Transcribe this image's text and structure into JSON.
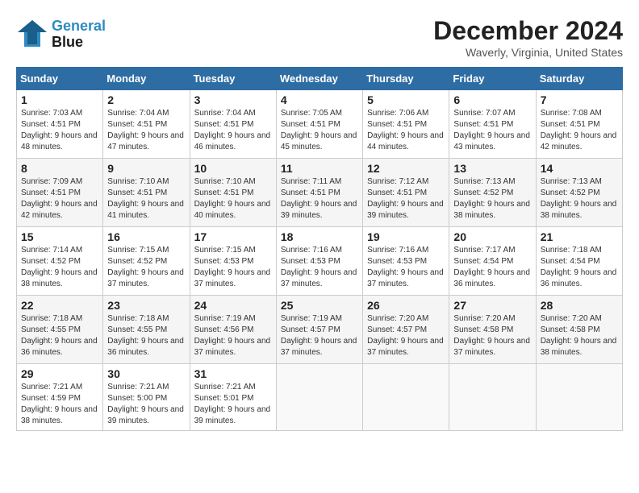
{
  "logo": {
    "line1": "General",
    "line2": "Blue"
  },
  "title": "December 2024",
  "location": "Waverly, Virginia, United States",
  "headers": [
    "Sunday",
    "Monday",
    "Tuesday",
    "Wednesday",
    "Thursday",
    "Friday",
    "Saturday"
  ],
  "weeks": [
    [
      {
        "day": "1",
        "sunrise": "7:03 AM",
        "sunset": "4:51 PM",
        "daylight": "9 hours and 48 minutes."
      },
      {
        "day": "2",
        "sunrise": "7:04 AM",
        "sunset": "4:51 PM",
        "daylight": "9 hours and 47 minutes."
      },
      {
        "day": "3",
        "sunrise": "7:04 AM",
        "sunset": "4:51 PM",
        "daylight": "9 hours and 46 minutes."
      },
      {
        "day": "4",
        "sunrise": "7:05 AM",
        "sunset": "4:51 PM",
        "daylight": "9 hours and 45 minutes."
      },
      {
        "day": "5",
        "sunrise": "7:06 AM",
        "sunset": "4:51 PM",
        "daylight": "9 hours and 44 minutes."
      },
      {
        "day": "6",
        "sunrise": "7:07 AM",
        "sunset": "4:51 PM",
        "daylight": "9 hours and 43 minutes."
      },
      {
        "day": "7",
        "sunrise": "7:08 AM",
        "sunset": "4:51 PM",
        "daylight": "9 hours and 42 minutes."
      }
    ],
    [
      {
        "day": "8",
        "sunrise": "7:09 AM",
        "sunset": "4:51 PM",
        "daylight": "9 hours and 42 minutes."
      },
      {
        "day": "9",
        "sunrise": "7:10 AM",
        "sunset": "4:51 PM",
        "daylight": "9 hours and 41 minutes."
      },
      {
        "day": "10",
        "sunrise": "7:10 AM",
        "sunset": "4:51 PM",
        "daylight": "9 hours and 40 minutes."
      },
      {
        "day": "11",
        "sunrise": "7:11 AM",
        "sunset": "4:51 PM",
        "daylight": "9 hours and 39 minutes."
      },
      {
        "day": "12",
        "sunrise": "7:12 AM",
        "sunset": "4:51 PM",
        "daylight": "9 hours and 39 minutes."
      },
      {
        "day": "13",
        "sunrise": "7:13 AM",
        "sunset": "4:52 PM",
        "daylight": "9 hours and 38 minutes."
      },
      {
        "day": "14",
        "sunrise": "7:13 AM",
        "sunset": "4:52 PM",
        "daylight": "9 hours and 38 minutes."
      }
    ],
    [
      {
        "day": "15",
        "sunrise": "7:14 AM",
        "sunset": "4:52 PM",
        "daylight": "9 hours and 38 minutes."
      },
      {
        "day": "16",
        "sunrise": "7:15 AM",
        "sunset": "4:52 PM",
        "daylight": "9 hours and 37 minutes."
      },
      {
        "day": "17",
        "sunrise": "7:15 AM",
        "sunset": "4:53 PM",
        "daylight": "9 hours and 37 minutes."
      },
      {
        "day": "18",
        "sunrise": "7:16 AM",
        "sunset": "4:53 PM",
        "daylight": "9 hours and 37 minutes."
      },
      {
        "day": "19",
        "sunrise": "7:16 AM",
        "sunset": "4:53 PM",
        "daylight": "9 hours and 37 minutes."
      },
      {
        "day": "20",
        "sunrise": "7:17 AM",
        "sunset": "4:54 PM",
        "daylight": "9 hours and 36 minutes."
      },
      {
        "day": "21",
        "sunrise": "7:18 AM",
        "sunset": "4:54 PM",
        "daylight": "9 hours and 36 minutes."
      }
    ],
    [
      {
        "day": "22",
        "sunrise": "7:18 AM",
        "sunset": "4:55 PM",
        "daylight": "9 hours and 36 minutes."
      },
      {
        "day": "23",
        "sunrise": "7:18 AM",
        "sunset": "4:55 PM",
        "daylight": "9 hours and 36 minutes."
      },
      {
        "day": "24",
        "sunrise": "7:19 AM",
        "sunset": "4:56 PM",
        "daylight": "9 hours and 37 minutes."
      },
      {
        "day": "25",
        "sunrise": "7:19 AM",
        "sunset": "4:57 PM",
        "daylight": "9 hours and 37 minutes."
      },
      {
        "day": "26",
        "sunrise": "7:20 AM",
        "sunset": "4:57 PM",
        "daylight": "9 hours and 37 minutes."
      },
      {
        "day": "27",
        "sunrise": "7:20 AM",
        "sunset": "4:58 PM",
        "daylight": "9 hours and 37 minutes."
      },
      {
        "day": "28",
        "sunrise": "7:20 AM",
        "sunset": "4:58 PM",
        "daylight": "9 hours and 38 minutes."
      }
    ],
    [
      {
        "day": "29",
        "sunrise": "7:21 AM",
        "sunset": "4:59 PM",
        "daylight": "9 hours and 38 minutes."
      },
      {
        "day": "30",
        "sunrise": "7:21 AM",
        "sunset": "5:00 PM",
        "daylight": "9 hours and 39 minutes."
      },
      {
        "day": "31",
        "sunrise": "7:21 AM",
        "sunset": "5:01 PM",
        "daylight": "9 hours and 39 minutes."
      },
      null,
      null,
      null,
      null
    ]
  ]
}
